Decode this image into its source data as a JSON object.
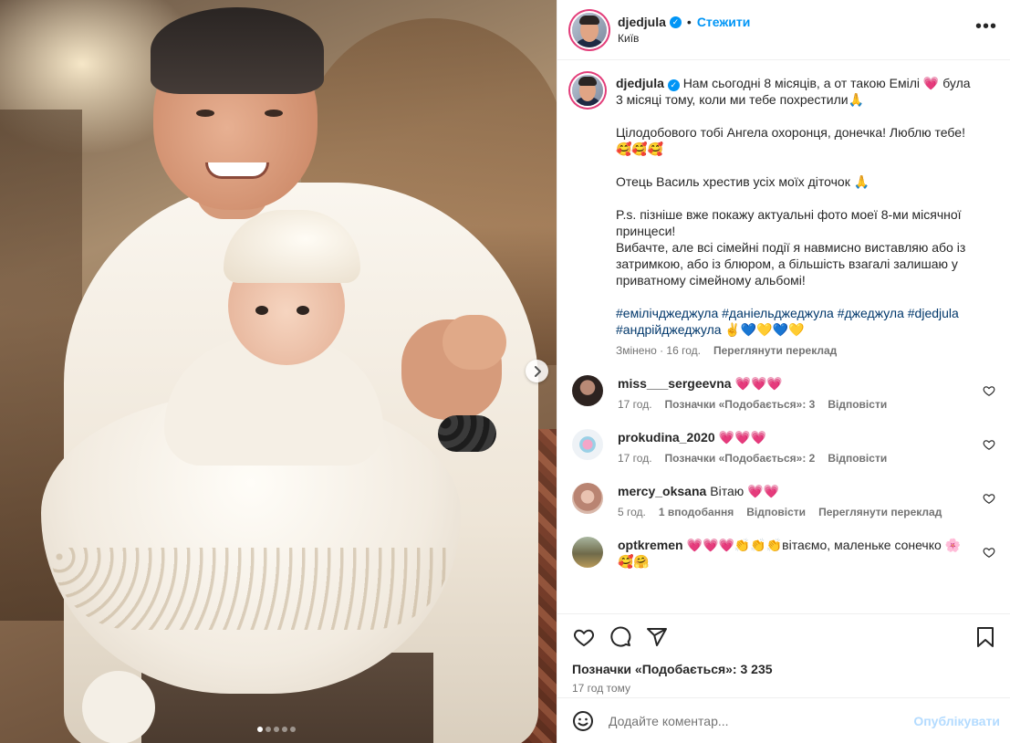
{
  "post": {
    "username": "djedjula",
    "follow_label": "Стежити",
    "separator": "•",
    "location": "Київ",
    "more_label": "•••",
    "carousel": {
      "slide_count": 5,
      "active_slide": 1
    }
  },
  "caption": {
    "username": "djedjula",
    "lines": [
      "Нам сьогодні 8 місяців, а от такою Емілі 💗 була 3 місяці тому, коли ми тебе похрестили🙏",
      "Цілодобового тобі Ангела охоронця, донечка! Люблю тебе! 🥰🥰🥰",
      "Отець Василь хрестив усіх моїх діточок 🙏",
      "P.s. пізніше вже покажу актуальні фото моеї 8-ми місячної принцеси!",
      "Вибачте, але всі сімейні події я навмисно виставляю або із затримкою, або із блюром, а більшість взагалі залишаю у приватному сімейному альбомі!"
    ],
    "hashtags": "#емілічджеджула #даніельджеджула #джеджула #djedjula #андрійджеджула ✌️💙💛💙💛",
    "edited": "Змінено · 16 год.",
    "see_translation": "Переглянути переклад"
  },
  "comments": [
    {
      "user": "miss___sergeevna",
      "text": "💗💗💗",
      "time": "17 год.",
      "likes": "Позначки «Подобається»: 3",
      "reply": "Відповісти",
      "translate": "",
      "avatar_color": "#3a2e2a"
    },
    {
      "user": "prokudina_2020",
      "text": "💗💗💗",
      "time": "17 год.",
      "likes": "Позначки «Подобається»: 2",
      "reply": "Відповісти",
      "translate": "",
      "avatar_color": "#dfe6ee"
    },
    {
      "user": "mercy_oksana",
      "text": "Вітаю 💗💗",
      "time": "5 год.",
      "likes": "1 вподобання",
      "reply": "Відповісти",
      "translate": "Переглянути переклад",
      "avatar_color": "#c59a8e"
    },
    {
      "user": "optkremen",
      "text": "💗💗💗👏👏👏вітаємо, маленьке сонечко 🌸🥰🤗",
      "time": "",
      "likes": "",
      "reply": "",
      "translate": "",
      "avatar_color": "#6f6a4a"
    }
  ],
  "footer": {
    "likes_text": "Позначки «Подобається»: 3 235",
    "time_ago": "17 год тому",
    "comment_placeholder": "Додайте коментар...",
    "post_button": "Опублікувати"
  },
  "colors": {
    "accent": "#0095f6",
    "link": "#00376b",
    "muted": "#737373",
    "heart": "#ed4956"
  }
}
